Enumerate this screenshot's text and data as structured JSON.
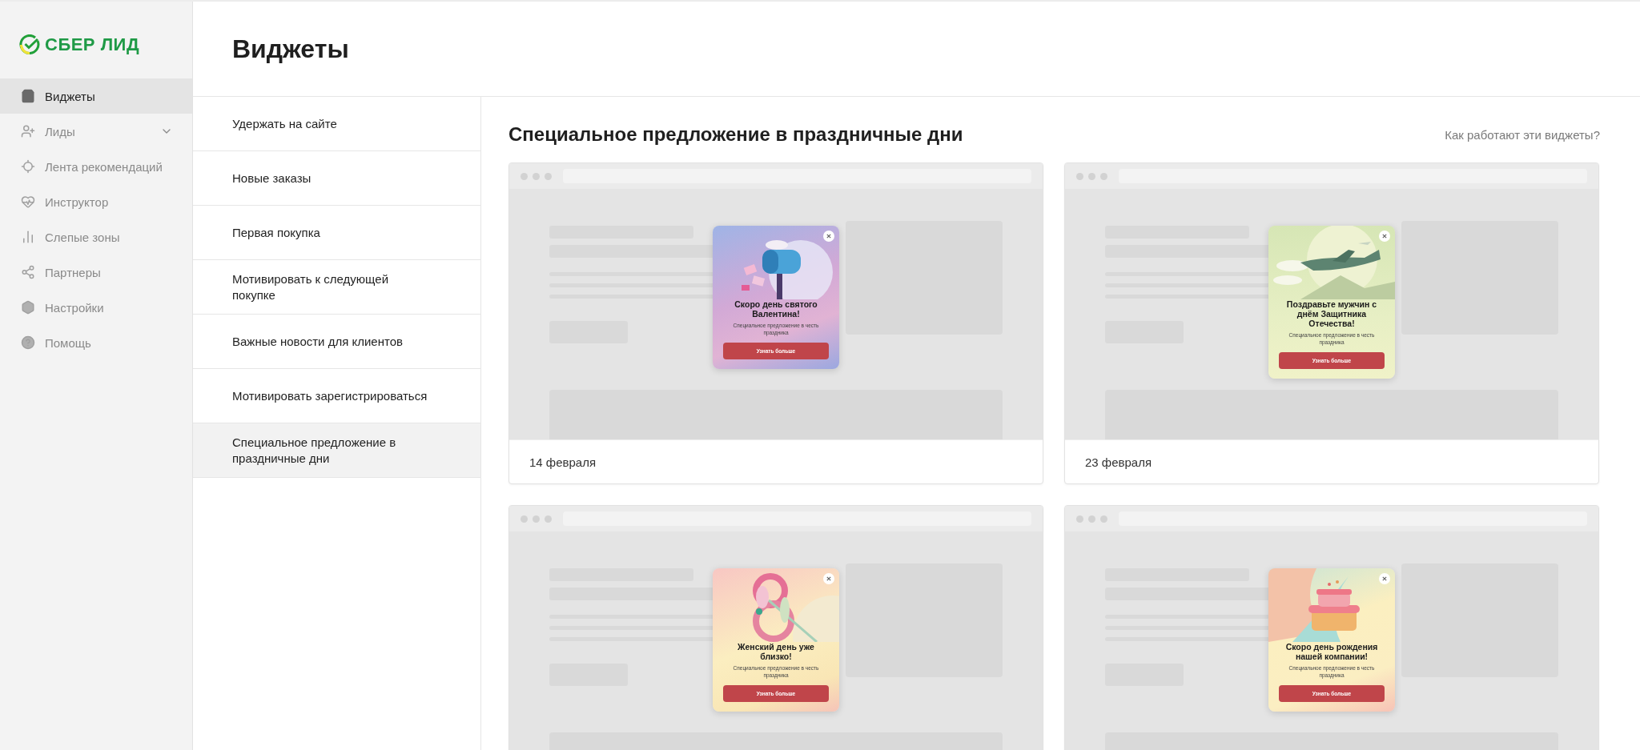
{
  "sidebar": {
    "logo": "СБЕР ЛИД",
    "items": [
      {
        "label": "Виджеты",
        "selected": true,
        "expandable": false
      },
      {
        "label": "Лиды",
        "selected": false,
        "expandable": true
      },
      {
        "label": "Лента рекомендаций",
        "selected": false,
        "expandable": false
      },
      {
        "label": "Инструктор",
        "selected": false,
        "expandable": false
      },
      {
        "label": "Слепые зоны",
        "selected": false,
        "expandable": false
      },
      {
        "label": "Партнеры",
        "selected": false,
        "expandable": false
      },
      {
        "label": "Настройки",
        "selected": false,
        "expandable": false
      },
      {
        "label": "Помощь",
        "selected": false,
        "expandable": false
      }
    ]
  },
  "page_title": "Виджеты",
  "categories": [
    {
      "label": "Удержать на сайте",
      "selected": false
    },
    {
      "label": "Новые заказы",
      "selected": false
    },
    {
      "label": "Первая покупка",
      "selected": false
    },
    {
      "label": "Мотивировать к следующей покупке",
      "selected": false
    },
    {
      "label": "Важные новости для клиентов",
      "selected": false
    },
    {
      "label": "Мотивировать зарегистрироваться",
      "selected": false
    },
    {
      "label": "Специальное предложение в праздничные дни",
      "selected": true
    }
  ],
  "section": {
    "title": "Специальное предложение в праздничные дни",
    "help_link": "Как работают эти виджеты?"
  },
  "widgets": [
    {
      "kind": "valentine",
      "caption": "14 февраля",
      "popup": {
        "title": "Скоро день святого Валентина!",
        "subtitle": "Специальное предложение в честь праздника",
        "button": "Узнать больше"
      }
    },
    {
      "kind": "defender",
      "caption": "23 февраля",
      "popup": {
        "title": "Поздравьте мужчин с днём Защитника Отечества!",
        "subtitle": "Специальное предложение в честь праздника",
        "button": "Узнать больше"
      }
    },
    {
      "kind": "women",
      "popup": {
        "title": "Женский день уже близко!",
        "subtitle": "Специальное предложение в честь праздника",
        "button": "Узнать больше"
      }
    },
    {
      "kind": "birthday",
      "popup": {
        "title": "Скоро день рождения нашей компании!",
        "subtitle": "Специальное предложение в честь праздника",
        "button": "Узнать больше"
      }
    }
  ]
}
